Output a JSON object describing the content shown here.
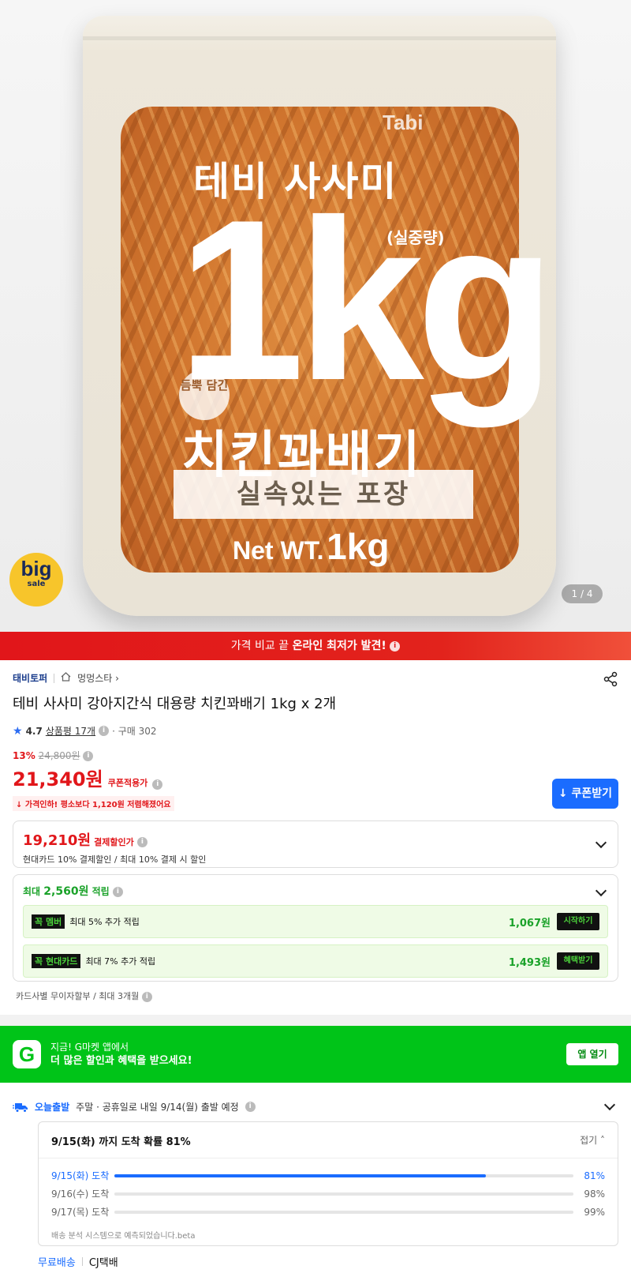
{
  "hero": {
    "bag_brand": "Tabi",
    "bag_line1": "테비 사사미",
    "bag_big": "1kg",
    "bag_sub": "(실중량)",
    "bag_badge": "듬뿍 담긴",
    "bag_title": "치킨꽈배기",
    "bag_banner": "실속있는 포장",
    "bag_net_a": "Net WT.",
    "bag_net_b": "1kg",
    "bigsale_top": "big",
    "bigsale_bottom": "sale",
    "pager": "1 / 4"
  },
  "strip": {
    "text_a": "가격 비교 끝",
    "text_b": "온라인 최저가 발견!"
  },
  "product": {
    "seller": "태비토퍼",
    "store": "멍멍스타",
    "store_icon": "home-icon",
    "title": "테비 사사미 강아지간식 대용량 치킨꽈배기 1kg x 2개",
    "rating": "4.7",
    "reviews": "상품평 17개",
    "purchases": "구매 302",
    "discount_pct": "13%",
    "original_price": "24,800원",
    "price": "21,340원",
    "price_label": "쿠폰적용가",
    "coupon_button": "쿠폰받기",
    "price_drop": "가격인하! 평소보다 1,120원 저렴해졌어요"
  },
  "payment": {
    "price": "19,210원",
    "label": "결제할인가",
    "desc": "현대카드 10% 결제할인 / 최대 10% 결제 시 할인"
  },
  "rewards": {
    "head_a": "최대",
    "head_amount": "2,560원",
    "head_b": "적립",
    "items": [
      {
        "tag": "꼭 멤버",
        "text": "최대 5% 추가 적립",
        "amount": "1,067원",
        "button": "시작하기"
      },
      {
        "tag": "꼭 현대카드",
        "text": "최대 7% 추가 적립",
        "amount": "1,493원",
        "button": "혜택받기"
      }
    ],
    "installment": "카드사별 무이자할부 / 최대 3개월"
  },
  "gbanner": {
    "logo": "G",
    "line1": "지금! G마켓 앱에서",
    "line2": "더 많은 할인과 혜택을 받으세요!",
    "button": "앱 열기"
  },
  "shipping": {
    "today_label": "오늘출발",
    "note": "주말 · 공휴일로 내일 9/14(월) 출발 예정",
    "estimate_title": "9/15(화) 까지 도착 확률 81%",
    "fold": "접기",
    "rows": [
      {
        "day": "9/15(화) 도착",
        "pct": "81%",
        "value": 0.81
      },
      {
        "day": "9/16(수) 도착",
        "pct": "98%",
        "value": 0.98
      },
      {
        "day": "9/17(목) 도착",
        "pct": "99%",
        "value": 0.99
      }
    ],
    "beta": "배송 분석 시스템으로 예측되었습니다.beta",
    "free": "무료배송",
    "carrier": "CJ택배"
  },
  "colors": {
    "accent_red": "#e1161a",
    "accent_blue": "#1a6cff",
    "accent_green": "#00c418"
  }
}
